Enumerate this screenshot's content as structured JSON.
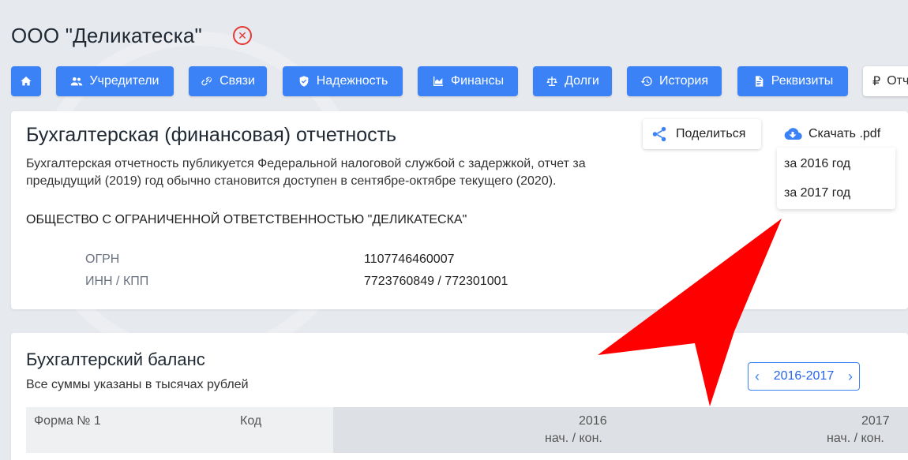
{
  "company": {
    "title": "ООО \"Деликатеска\""
  },
  "nav": {
    "items": [
      {
        "label": ""
      },
      {
        "label": "Учредители"
      },
      {
        "label": "Связи"
      },
      {
        "label": "Надежность"
      },
      {
        "label": "Финансы"
      },
      {
        "label": "Долги"
      },
      {
        "label": "История"
      },
      {
        "label": "Реквизиты"
      },
      {
        "label": "Отч"
      }
    ],
    "ruble_symbol": "₽"
  },
  "report": {
    "title": "Бухгалтерская (финансовая) отчетность",
    "description": "Бухгалтерская отчетность публикуется Федеральной налоговой службой с задержкой, отчет за предыдущий (2019) год обычно становится доступен в сентябре-октябре текущего (2020).",
    "org_name": "ОБЩЕСТВО С ОГРАНИЧЕННОЙ ОТВЕТСТВЕННОСТЬЮ \"ДЕЛИКАТЕСКА\"",
    "fields": [
      {
        "label": "ОГРН",
        "value": "1107746460007"
      },
      {
        "label": "ИНН / КПП",
        "value": "7723760849 / 772301001"
      }
    ],
    "share_label": "Поделиться",
    "download_label": "Скачать .pdf",
    "download_options": [
      "за 2016 год",
      "за 2017 год"
    ]
  },
  "balance": {
    "title": "Бухгалтерский баланс",
    "subtitle": "Все суммы указаны в тысячах рублей",
    "period": "2016-2017",
    "prev_symbol": "‹",
    "next_symbol": "›",
    "columns": {
      "form": "Форма № 1",
      "code": "Код",
      "year1": "2016",
      "year1_sub": "нач. / кон.",
      "year2": "2017",
      "year2_sub": "нач. / кон."
    }
  },
  "colors": {
    "accent": "#3b82f6",
    "close": "#e53935",
    "arrow": "#ff0000"
  }
}
